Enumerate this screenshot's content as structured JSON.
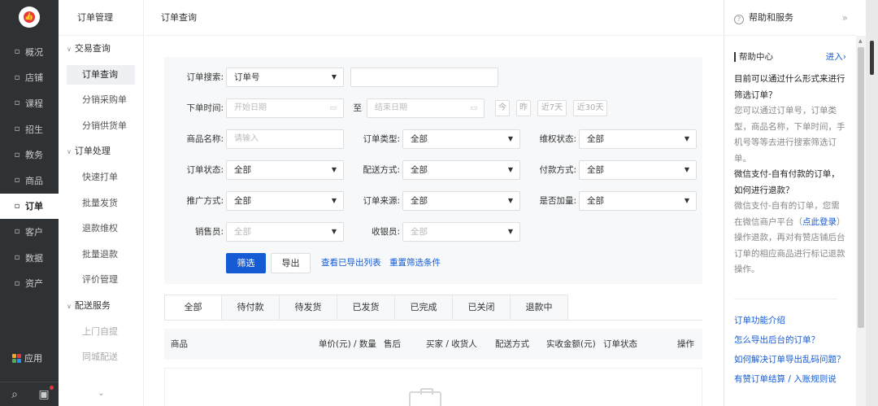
{
  "nav": {
    "items": [
      {
        "icon": "概",
        "label": "概况"
      },
      {
        "icon": "店",
        "label": "店铺"
      },
      {
        "icon": "课",
        "label": "课程"
      },
      {
        "icon": "招",
        "label": "招生"
      },
      {
        "icon": "教",
        "label": "教务"
      },
      {
        "icon": "商",
        "label": "商品"
      },
      {
        "icon": "单",
        "label": "订单",
        "active": true
      },
      {
        "icon": "客",
        "label": "客户"
      },
      {
        "icon": "数",
        "label": "数据"
      },
      {
        "icon": "资",
        "label": "资产"
      }
    ],
    "apps_label": "应用",
    "search_glyph": "⌕",
    "msg_glyph": "▣"
  },
  "subnav": {
    "title": "订单管理",
    "groups": [
      {
        "label": "交易查询",
        "items": [
          "订单查询",
          "分销采购单",
          "分销供货单"
        ]
      },
      {
        "label": "订单处理",
        "items": [
          "快速打单",
          "批量发货",
          "退款维权",
          "批量退款",
          "评价管理"
        ]
      },
      {
        "label": "配送服务",
        "items": [
          "上门自提",
          "同城配送"
        ]
      }
    ],
    "more": "⌄"
  },
  "main": {
    "title": "订单查询",
    "filter": {
      "search_label": "订单搜索:",
      "search_type": "订单号",
      "time_label": "下单时间:",
      "start_placeholder": "开始日期",
      "to": "至",
      "end_placeholder": "结束日期",
      "quick": [
        "今",
        "昨",
        "近7天",
        "近30天"
      ],
      "product_label": "商品名称:",
      "product_placeholder": "请输入",
      "order_type_label": "订单类型:",
      "order_type": "全部",
      "rights_label": "维权状态:",
      "rights": "全部",
      "status_label": "订单状态:",
      "status": "全部",
      "delivery_label": "配送方式:",
      "delivery": "全部",
      "pay_label": "付款方式:",
      "pay": "全部",
      "promo_label": "推广方式:",
      "promo": "全部",
      "source_label": "订单来源:",
      "source": "全部",
      "addon_label": "是否加量:",
      "addon": "全部",
      "seller_label": "销售员:",
      "seller": "全部",
      "cashier_label": "收银员:",
      "cashier": "全部",
      "filter_btn": "筛选",
      "export_btn": "导出",
      "view_export": "查看已导出列表",
      "reset": "重置筛选条件"
    },
    "tabs": [
      "全部",
      "待付款",
      "待发货",
      "已发货",
      "已完成",
      "已关闭",
      "退款中"
    ],
    "columns": [
      "商品",
      "单价(元) / 数量",
      "售后",
      "买家 / 收货人",
      "配送方式",
      "实收金额(元)",
      "订单状态",
      "操作"
    ]
  },
  "help": {
    "title": "帮助和服务",
    "center": "帮助中心",
    "enter": "进入›",
    "q1": "目前可以通过什么形式来进行筛选订单？",
    "a1": "您可以通过订单号，订单类型，商品名称，下单时间，手机号等等去进行搜索筛选订单。",
    "q2": "微信支付-自有付款的订单，如何进行退款？",
    "a2_pre": "微信支付-自有的订单，您需在微信商户平台（",
    "a2_link": "点此登录",
    "a2_post": "）操作退款，再对有赞店铺后台订单的相应商品进行标记退款操作。",
    "links": [
      "订单功能介绍",
      "怎么导出后台的订单？",
      "如何解决订单导出乱码问题？",
      "有赞订单结算 / 入账规则说"
    ]
  },
  "colors": {
    "primary": "#155bd4",
    "nav_bg": "#2f3234",
    "logo_red": "#e8363d"
  }
}
